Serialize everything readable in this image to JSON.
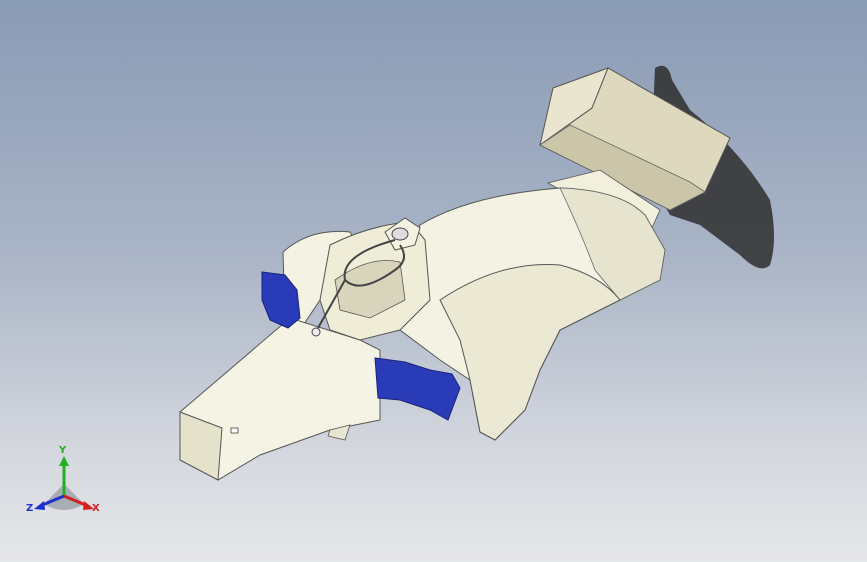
{
  "viewport": {
    "background_top": "#8a9bb5",
    "background_bottom": "#e6e7ea",
    "model_body_color": "#f3f1e2",
    "model_shadow_color": "#3c3c3c",
    "sidepod_flap_color": "#2a3bb8"
  },
  "triad": {
    "x_label": "X",
    "y_label": "Y",
    "z_label": "Z",
    "x_color": "#d42020",
    "y_color": "#20b020",
    "z_color": "#2030d0"
  }
}
